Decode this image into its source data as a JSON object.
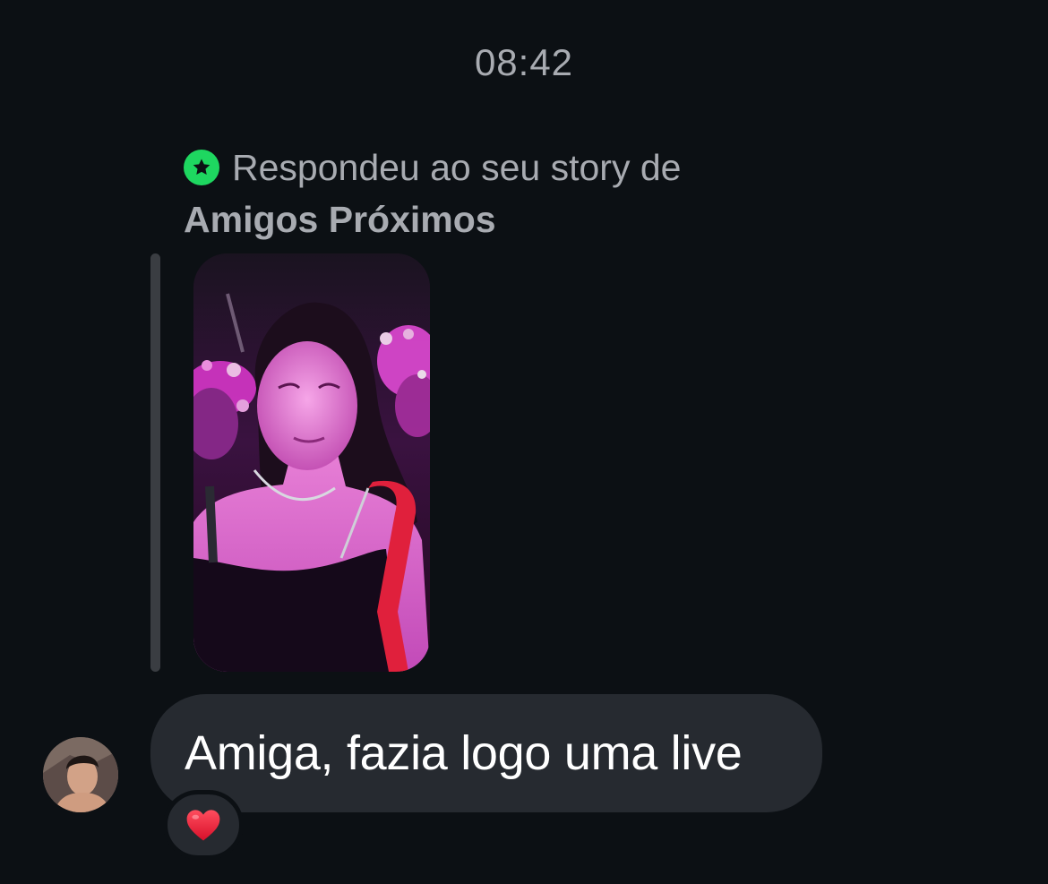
{
  "thread": {
    "timestamp": "08:42",
    "story_reply": {
      "label": "Respondeu ao seu story de",
      "audience": "Amigos Próximos",
      "icon": "close-friends-star-icon",
      "icon_color": "#1ed760"
    },
    "message": {
      "text": "Amiga, fazia logo uma live",
      "reaction": "❤️",
      "reaction_icon": "red-heart-icon"
    }
  },
  "colors": {
    "background": "#0c1014",
    "bubble": "#262a30",
    "meta_text": "#a8abb1",
    "message_text": "#ffffff"
  }
}
